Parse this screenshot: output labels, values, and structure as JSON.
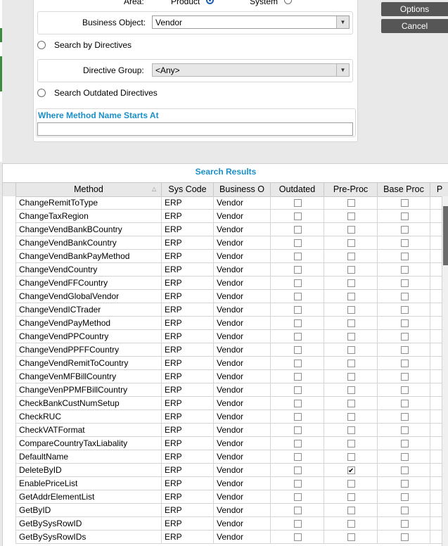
{
  "search": {
    "area_label": "Area:",
    "product_label": "Product",
    "system_label": "System",
    "business_object_label": "Business Object:",
    "business_object_value": "Vendor",
    "search_by_directives_label": "Search by Directives",
    "directive_group_label": "Directive Group:",
    "directive_group_value": "<Any>",
    "search_outdated_label": "Search Outdated Directives",
    "where_title": "Where Method Name Starts At",
    "where_value": ""
  },
  "actions": {
    "options_label": "Options",
    "cancel_label": "Cancel"
  },
  "results": {
    "title": "Search Results",
    "columns": [
      "Method",
      "Sys Code",
      "Business O",
      "Outdated",
      "Pre-Proc",
      "Base Proc",
      "P"
    ],
    "rows": [
      {
        "method": "ChangeRemitToType",
        "sys": "ERP",
        "bo": "Vendor",
        "outdated": false,
        "pre": false,
        "base": false
      },
      {
        "method": "ChangeTaxRegion",
        "sys": "ERP",
        "bo": "Vendor",
        "outdated": false,
        "pre": false,
        "base": false
      },
      {
        "method": "ChangeVendBankBCountry",
        "sys": "ERP",
        "bo": "Vendor",
        "outdated": false,
        "pre": false,
        "base": false
      },
      {
        "method": "ChangeVendBankCountry",
        "sys": "ERP",
        "bo": "Vendor",
        "outdated": false,
        "pre": false,
        "base": false
      },
      {
        "method": "ChangeVendBankPayMethod",
        "sys": "ERP",
        "bo": "Vendor",
        "outdated": false,
        "pre": false,
        "base": false
      },
      {
        "method": "ChangeVendCountry",
        "sys": "ERP",
        "bo": "Vendor",
        "outdated": false,
        "pre": false,
        "base": false
      },
      {
        "method": "ChangeVendFFCountry",
        "sys": "ERP",
        "bo": "Vendor",
        "outdated": false,
        "pre": false,
        "base": false
      },
      {
        "method": "ChangeVendGlobalVendor",
        "sys": "ERP",
        "bo": "Vendor",
        "outdated": false,
        "pre": false,
        "base": false
      },
      {
        "method": "ChangeVendICTrader",
        "sys": "ERP",
        "bo": "Vendor",
        "outdated": false,
        "pre": false,
        "base": false
      },
      {
        "method": "ChangeVendPayMethod",
        "sys": "ERP",
        "bo": "Vendor",
        "outdated": false,
        "pre": false,
        "base": false
      },
      {
        "method": "ChangeVendPPCountry",
        "sys": "ERP",
        "bo": "Vendor",
        "outdated": false,
        "pre": false,
        "base": false
      },
      {
        "method": "ChangeVendPPFFCountry",
        "sys": "ERP",
        "bo": "Vendor",
        "outdated": false,
        "pre": false,
        "base": false
      },
      {
        "method": "ChangeVendRemitToCountry",
        "sys": "ERP",
        "bo": "Vendor",
        "outdated": false,
        "pre": false,
        "base": false
      },
      {
        "method": "ChangeVenMFBillCountry",
        "sys": "ERP",
        "bo": "Vendor",
        "outdated": false,
        "pre": false,
        "base": false
      },
      {
        "method": "ChangeVenPPMFBillCountry",
        "sys": "ERP",
        "bo": "Vendor",
        "outdated": false,
        "pre": false,
        "base": false
      },
      {
        "method": "CheckBankCustNumSetup",
        "sys": "ERP",
        "bo": "Vendor",
        "outdated": false,
        "pre": false,
        "base": false
      },
      {
        "method": "CheckRUC",
        "sys": "ERP",
        "bo": "Vendor",
        "outdated": false,
        "pre": false,
        "base": false
      },
      {
        "method": "CheckVATFormat",
        "sys": "ERP",
        "bo": "Vendor",
        "outdated": false,
        "pre": false,
        "base": false
      },
      {
        "method": "CompareCountryTaxLiabality",
        "sys": "ERP",
        "bo": "Vendor",
        "outdated": false,
        "pre": false,
        "base": false
      },
      {
        "method": "DefaultName",
        "sys": "ERP",
        "bo": "Vendor",
        "outdated": false,
        "pre": false,
        "base": false
      },
      {
        "method": "DeleteByID",
        "sys": "ERP",
        "bo": "Vendor",
        "outdated": false,
        "pre": true,
        "base": false
      },
      {
        "method": "EnablePriceList",
        "sys": "ERP",
        "bo": "Vendor",
        "outdated": false,
        "pre": false,
        "base": false
      },
      {
        "method": "GetAddrElementList",
        "sys": "ERP",
        "bo": "Vendor",
        "outdated": false,
        "pre": false,
        "base": false
      },
      {
        "method": "GetByID",
        "sys": "ERP",
        "bo": "Vendor",
        "outdated": false,
        "pre": false,
        "base": false
      },
      {
        "method": "GetBySysRowID",
        "sys": "ERP",
        "bo": "Vendor",
        "outdated": false,
        "pre": false,
        "base": false
      },
      {
        "method": "GetBySysRowIDs",
        "sys": "ERP",
        "bo": "Vendor",
        "outdated": false,
        "pre": false,
        "base": false
      }
    ]
  }
}
